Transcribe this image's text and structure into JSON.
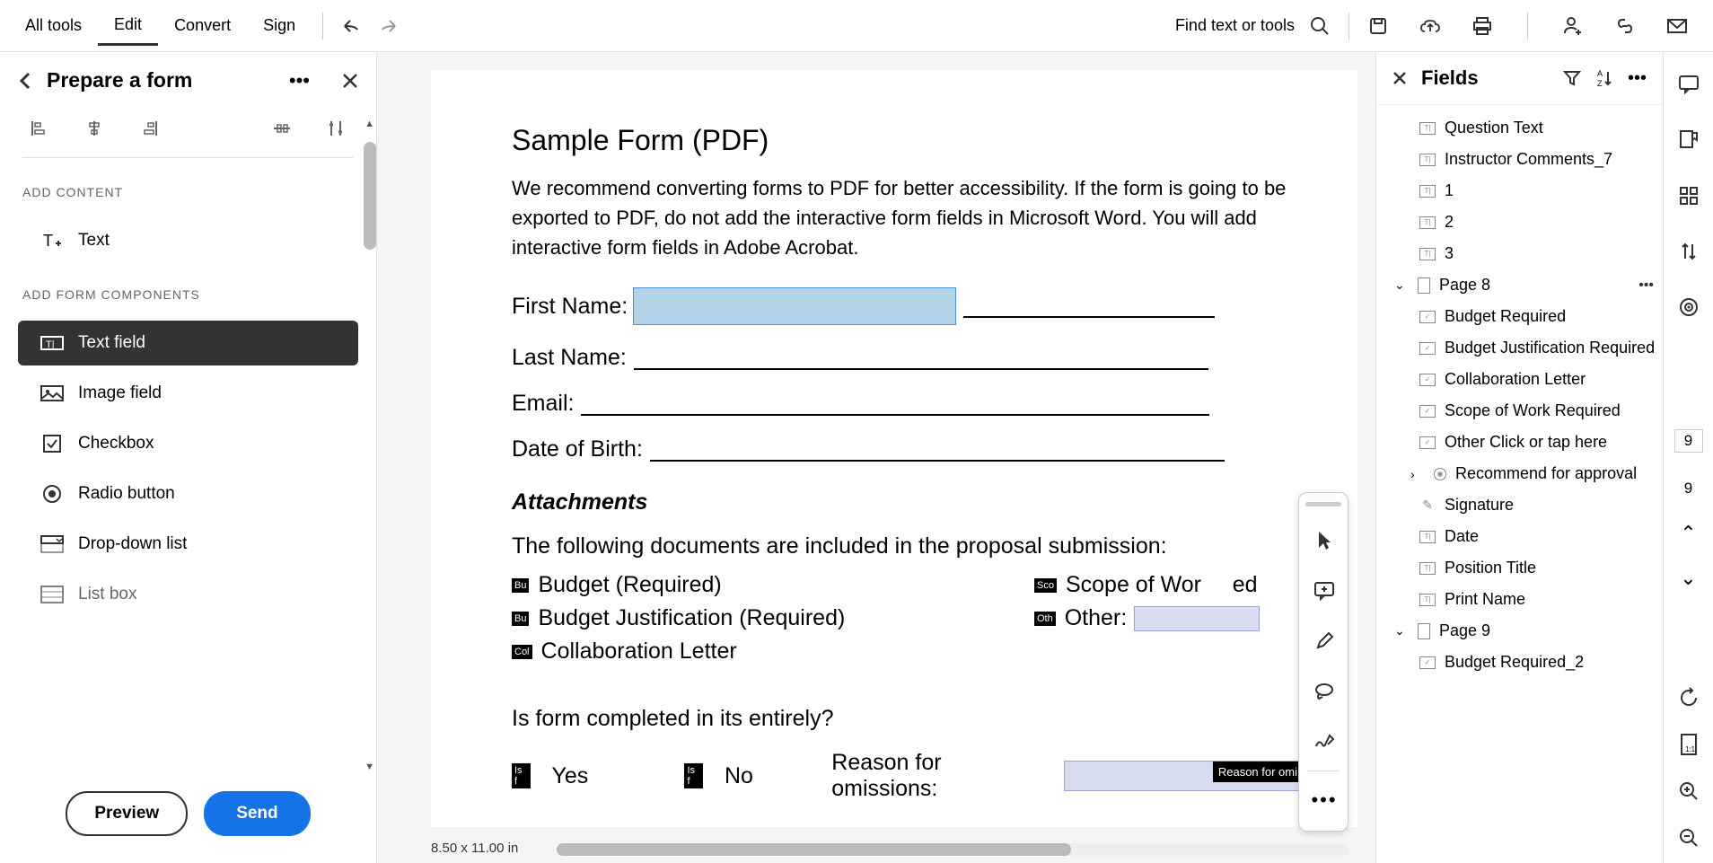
{
  "toolbar": {
    "all_tools": "All tools",
    "edit": "Edit",
    "convert": "Convert",
    "sign": "Sign",
    "find_text": "Find text or tools"
  },
  "left_panel": {
    "title": "Prepare a form",
    "add_content_label": "ADD CONTENT",
    "text_tool": "Text",
    "add_form_label": "ADD FORM COMPONENTS",
    "text_field": "Text field",
    "image_field": "Image field",
    "checkbox": "Checkbox",
    "radio_button": "Radio button",
    "dropdown": "Drop-down list",
    "listbox": "List box",
    "preview_btn": "Preview",
    "send_btn": "Send"
  },
  "document": {
    "title": "Sample Form (PDF)",
    "intro": "We recommend converting forms to PDF for better accessibility. If the form is going to be exported to PDF, do not add the interactive form fields in Microsoft Word. You will add interactive form fields in Adobe Acrobat.",
    "first_name_label": "First Name:",
    "last_name_label": "Last Name:",
    "email_label": "Email:",
    "dob_label": "Date of Birth:",
    "attachments_heading": "Attachments",
    "attachments_intro": "The following documents are included in the proposal submission:",
    "budget_tag": "Bu",
    "budget_label": "Budget (Required)",
    "budget_just_tag": "Bu",
    "budget_just_label": "Budget Justification (Required)",
    "collab_tag": "Col",
    "collab_label": "Collaboration Letter",
    "scope_tag": "Sco",
    "scope_label": "Scope of Work (Required)",
    "other_tag": "Oth",
    "other_label": "Other:",
    "complete_question": "Is form completed in its entirely?",
    "yes_tag": "Is f",
    "yes_label": "Yes",
    "no_tag": "Is f",
    "no_label": "No",
    "reason_label": "Reason for omissions:",
    "reason_field_tag": "Reason for omi",
    "page_size": "8.50 x 11.00 in"
  },
  "fields_panel": {
    "title": "Fields",
    "items": [
      {
        "type": "text",
        "name": "Question Text"
      },
      {
        "type": "text",
        "name": "Instructor Comments_7"
      },
      {
        "type": "text",
        "name": "1"
      },
      {
        "type": "text",
        "name": "2"
      },
      {
        "type": "text",
        "name": "3"
      }
    ],
    "page8_label": "Page 8",
    "page8_items": [
      {
        "type": "checkbox",
        "name": "Budget Required"
      },
      {
        "type": "checkbox",
        "name": "Budget Justification Required"
      },
      {
        "type": "checkbox",
        "name": "Collaboration Letter"
      },
      {
        "type": "checkbox",
        "name": "Scope of Work Required"
      },
      {
        "type": "checkbox",
        "name": "Other Click or tap here"
      },
      {
        "type": "radio",
        "name": "Recommend for approval"
      },
      {
        "type": "signature",
        "name": "Signature"
      },
      {
        "type": "text",
        "name": "Date"
      },
      {
        "type": "text",
        "name": "Position Title"
      },
      {
        "type": "text",
        "name": "Print Name"
      }
    ],
    "page9_label": "Page 9",
    "page9_items": [
      {
        "type": "checkbox",
        "name": "Budget Required_2"
      }
    ]
  },
  "ribbon": {
    "current_page": "9",
    "total_pages": "9"
  }
}
